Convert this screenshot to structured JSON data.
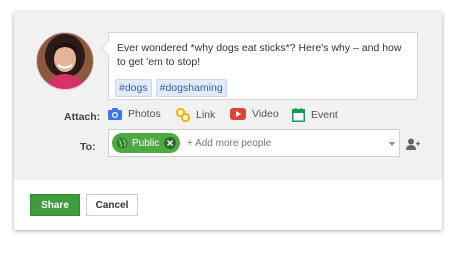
{
  "post": {
    "text": "Ever wondered *why dogs eat sticks*? Here's why – and how to get 'em to stop!",
    "tags": [
      "#dogs",
      "#dogshaming"
    ]
  },
  "attach": {
    "label": "Attach:",
    "items": [
      {
        "label": "Photos",
        "icon": "camera-icon",
        "color": "#3b78e7"
      },
      {
        "label": "Link",
        "icon": "link-icon",
        "color": "#f4b400"
      },
      {
        "label": "Video",
        "icon": "video-icon",
        "color": "#db4437"
      },
      {
        "label": "Event",
        "icon": "calendar-icon",
        "color": "#0f9d58"
      }
    ]
  },
  "to": {
    "label": "To:",
    "chip": "Public",
    "placeholder": "+ Add more people"
  },
  "buttons": {
    "share": "Share",
    "cancel": "Cancel"
  },
  "colors": {
    "chip_green": "#4fa942",
    "share_green": "#3d9c3b",
    "tag_bg": "#e3ebf9",
    "tag_text": "#3b5db0"
  }
}
